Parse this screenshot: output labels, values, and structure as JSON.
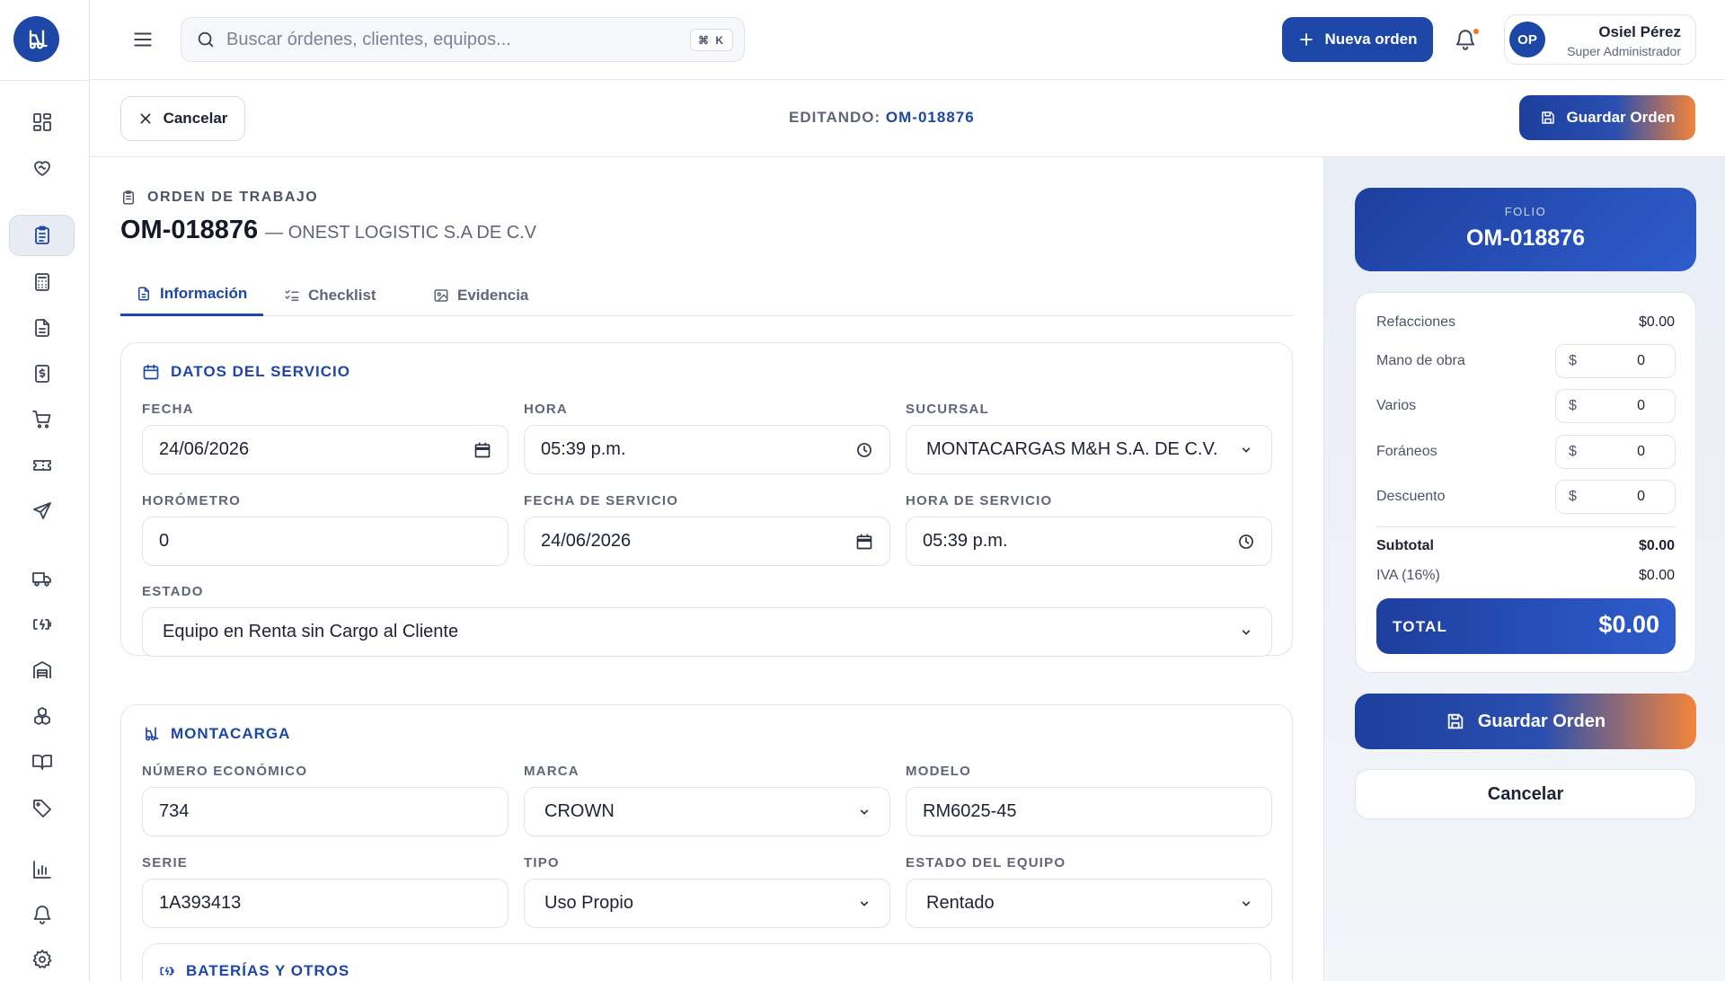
{
  "sidebar": {
    "logo_icon": "forklift-logo-icon",
    "items": [
      {
        "icon": "dashboard-grid-icon"
      },
      {
        "icon": "heart-handshake-icon"
      },
      {
        "icon": "clipboard-list-icon",
        "active": true
      },
      {
        "icon": "calculator-icon"
      },
      {
        "icon": "document-icon"
      },
      {
        "icon": "dollar-receipt-icon"
      },
      {
        "icon": "shopping-cart-icon"
      },
      {
        "icon": "ticket-icon"
      },
      {
        "icon": "send-icon"
      },
      {
        "icon": "truck-icon"
      },
      {
        "icon": "battery-charging-icon"
      },
      {
        "icon": "warehouse-icon"
      },
      {
        "icon": "boxes-icon"
      },
      {
        "icon": "book-open-icon"
      },
      {
        "icon": "tag-icon"
      },
      {
        "icon": "bar-chart-icon"
      },
      {
        "icon": "bell-icon"
      },
      {
        "icon": "settings-gear-icon"
      }
    ]
  },
  "header": {
    "search_placeholder": "Buscar órdenes, clientes, equipos...",
    "search_shortcut": "⌘ K",
    "new_order_label": "Nueva orden",
    "has_notifications": true,
    "user": {
      "initials": "OP",
      "name": "Osiel Pérez",
      "role": "Super Administrador"
    }
  },
  "editbar": {
    "cancel_label": "Cancelar",
    "editing_prefix": "EDITANDO:",
    "editing_code": "OM-018876",
    "save_label": "Guardar Orden"
  },
  "order": {
    "section_label": "ORDEN DE TRABAJO",
    "code": "OM-018876",
    "client": "— ONEST LOGISTIC S.A DE C.V"
  },
  "tabs": [
    {
      "label": "Información",
      "active": true
    },
    {
      "label": "Checklist",
      "active": false
    },
    {
      "label": "Evidencia",
      "active": false
    }
  ],
  "service": {
    "title": "DATOS DEL SERVICIO",
    "fecha_label": "FECHA",
    "fecha_value": "24/06/2026",
    "hora_label": "HORA",
    "hora_value": "05:39 p.m.",
    "sucursal_label": "SUCURSAL",
    "sucursal_value": "MONTACARGAS M&H S.A. DE C.V.",
    "horometro_label": "HORÓMETRO",
    "horometro_value": "0",
    "fecha_servicio_label": "FECHA DE SERVICIO",
    "fecha_servicio_value": "24/06/2026",
    "hora_servicio_label": "HORA DE SERVICIO",
    "hora_servicio_value": "05:39 p.m.",
    "estado_label": "ESTADO",
    "estado_value": "Equipo en Renta sin Cargo al Cliente"
  },
  "forklift": {
    "title": "MONTACARGA",
    "numero_label": "NÚMERO ECONÓMICO",
    "numero_value": "734",
    "marca_label": "MARCA",
    "marca_value": "CROWN",
    "modelo_label": "MODELO",
    "modelo_value": "RM6025-45",
    "serie_label": "SERIE",
    "serie_value": "1A393413",
    "tipo_label": "TIPO",
    "tipo_value": "Uso Propio",
    "estado_equipo_label": "ESTADO DEL EQUIPO",
    "estado_equipo_value": "Rentado",
    "batteries_title": "BATERÍAS Y OTROS"
  },
  "summary": {
    "folio_label": "FOLIO",
    "folio_code": "OM-018876",
    "refacciones_label": "Refacciones",
    "refacciones_value": "$0.00",
    "mano_obra_label": "Mano de obra",
    "mano_obra_value": "0",
    "varios_label": "Varios",
    "varios_value": "0",
    "foraneos_label": "Foráneos",
    "foraneos_value": "0",
    "descuento_label": "Descuento",
    "descuento_value": "0",
    "currency_symbol": "$",
    "subtotal_label": "Subtotal",
    "subtotal_value": "$0.00",
    "iva_label": "IVA (16%)",
    "iva_value": "$0.00",
    "total_label": "TOTAL",
    "total_value": "$0.00",
    "save_label": "Guardar Orden",
    "cancel_label": "Cancelar"
  },
  "colors": {
    "brand": "#1d47a6",
    "accent_orange": "#f4843a",
    "notification": "#f97316"
  }
}
